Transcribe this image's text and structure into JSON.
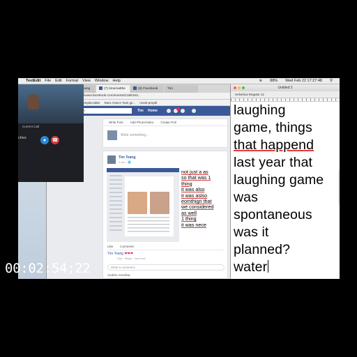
{
  "menubar": {
    "app": "TextEdit",
    "items": [
      "File",
      "Edit",
      "Format",
      "View",
      "Window",
      "Help"
    ],
    "clock": "Wed Feb 22  17:27:48",
    "battery": "88%"
  },
  "call": {
    "label": "Current Call",
    "side_text": "ches"
  },
  "browser": {
    "tabs": [
      "(7) Tim Teang",
      "(7) timematthe",
      "(8) Facebook",
      "Tim"
    ],
    "secure": "Secure",
    "url": "https://www.facebook.com/events/1189153...",
    "bookmarks": [
      "Apps",
      "Bookmarks",
      "SimpleAdder",
      "Rare Aztecs Twin ge...",
      "monk-prepbl"
    ],
    "fb_search_placeholder": "Search Facebook",
    "fb_user": "Tim",
    "fb_home": "Home",
    "composer_actions": [
      "Write Post",
      "Add Photo/Video",
      "Create Poll"
    ],
    "composer_prompt": "Write something...",
    "post_author": "Tim Teang",
    "post_time": "1 sec · 🌐",
    "reactions": [
      "Like",
      "Comment"
    ],
    "comment_author": "Tim Teang",
    "comment_hearts": "❤❤❤",
    "comment_meta": "Like · Reply · Just now",
    "write_comment_placeholder": "Write a comment...",
    "footer_user": "Andrés Azeolina",
    "chat": "Chat (79)"
  },
  "inner_notes": [
    "not just a as",
    "so that was 1",
    "thing",
    "it was also",
    "it was aslso",
    "eomthign that",
    "we considered",
    "as well",
    "1 thing",
    "it was nece"
  ],
  "editor": {
    "title": "Untitled 2",
    "toolbar": "Helvetica  Regular  12",
    "lines": [
      "laughing",
      "game, things",
      "that happend",
      "last year that",
      "laughing game",
      "was",
      "spontaneous",
      "was it",
      "planned?",
      "water"
    ]
  },
  "timecode": "00:02:54;22"
}
